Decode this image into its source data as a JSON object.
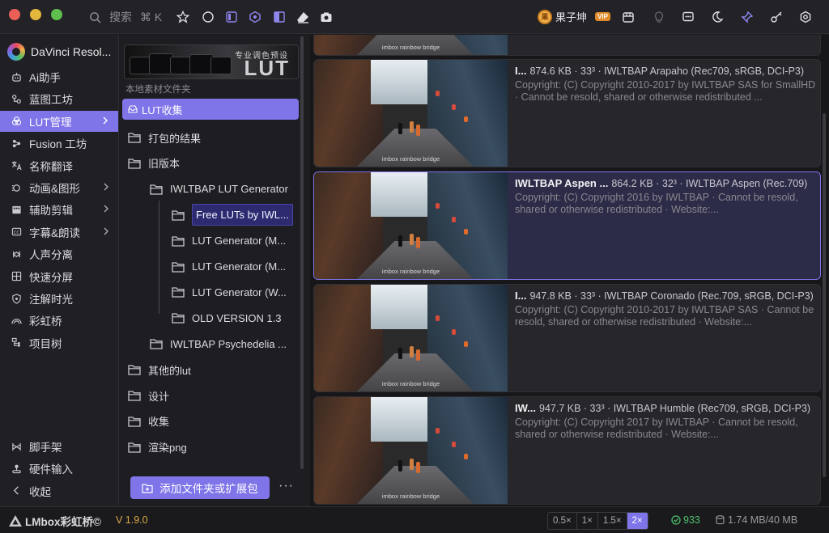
{
  "window": {
    "search_placeholder": "搜索",
    "search_shortcut": "⌘ K",
    "user_name": "果子坤",
    "user_badge": "VIP"
  },
  "sidebar": {
    "app_title": "DaVinci Resol...",
    "items": [
      {
        "label": "Ai助手",
        "icon": "robot-icon"
      },
      {
        "label": "蓝图工坊",
        "icon": "blueprint-icon"
      },
      {
        "label": "LUT管理",
        "icon": "color-circles-icon",
        "active": true
      },
      {
        "label": "Fusion 工坊",
        "icon": "fusion-icon"
      },
      {
        "label": "名称翻译",
        "icon": "translate-icon"
      },
      {
        "label": "动画&图形",
        "icon": "animation-icon"
      },
      {
        "label": "辅助剪辑",
        "icon": "film-icon"
      },
      {
        "label": "字幕&朗读",
        "icon": "caption-icon"
      },
      {
        "label": "人声分离",
        "icon": "vocal-icon"
      },
      {
        "label": "快速分屏",
        "icon": "grid-icon"
      },
      {
        "label": "注解时光",
        "icon": "note-icon"
      },
      {
        "label": "彩虹桥",
        "icon": "rainbow-icon"
      },
      {
        "label": "项目树",
        "icon": "tree-icon"
      }
    ],
    "bottom_items": [
      {
        "label": "脚手架",
        "icon": "scaffold-icon"
      },
      {
        "label": "硬件输入",
        "icon": "joystick-icon"
      },
      {
        "label": "收起",
        "icon": "collapse-icon"
      }
    ]
  },
  "tree": {
    "banner_title": "专业调色预设",
    "banner_big": "LUT",
    "section_label": "本地素材文件夹",
    "root": "LUT收集",
    "folders": [
      {
        "label": "打包的结果"
      },
      {
        "label": "旧版本"
      },
      {
        "label": "IWLTBAP LUT Generator"
      },
      {
        "label": "Free LUTs by IWL..."
      },
      {
        "label": "LUT Generator (M..."
      },
      {
        "label": "LUT Generator (M..."
      },
      {
        "label": "LUT Generator (W..."
      },
      {
        "label": "OLD VERSION 1.3"
      },
      {
        "label": "IWLTBAP Psychedelia ..."
      },
      {
        "label": "其他的lut"
      },
      {
        "label": "设计"
      },
      {
        "label": "收集"
      },
      {
        "label": "渲染png"
      }
    ],
    "add_button": "添加文件夹或扩展包",
    "more_button": "···"
  },
  "thumb_caption": "imbox rainbow bridge",
  "luts": [
    {
      "name": "I...",
      "meta": "874.6 KB · 33³ · IWLTBAP Arapaho (Rec709, sRGB, DCI-P3)",
      "desc": "Copyright: (C) Copyright 2010-2017 by IWLTBAP SAS for SmallHD · Cannot be resold, shared or otherwise redistributed ..."
    },
    {
      "name": "IWLTBAP Aspen ...",
      "meta": "864.2 KB · 32³ · IWLTBAP Aspen (Rec.709)",
      "desc": "Copyright: (C) Copyright 2016 by IWLTBAP · Cannot be resold, shared or otherwise redistributed · Website:...",
      "selected": true
    },
    {
      "name": "I...",
      "meta": "947.8 KB · 33³ · IWLTBAP Coronado (Rec.709, sRGB, DCI-P3)",
      "desc": "Copyright: (C) Copyright 2010-2017 by IWLTBAP SAS · Cannot be resold, shared or otherwise redistributed · Website:..."
    },
    {
      "name": "IW...",
      "meta": "947.7 KB · 33³ · IWLTBAP Humble (Rec709, sRGB, DCI-P3)",
      "desc": "Copyright: (C) Copyright 2017 by IWLTBAP · Cannot be resold, shared or otherwise redistributed · Website:..."
    }
  ],
  "status": {
    "brand": "LMbox彩虹桥©",
    "version": "V 1.9.0",
    "zoom_options": [
      "0.5×",
      "1×",
      "1.5×",
      "2×"
    ],
    "zoom_selected": "2×",
    "count": "933",
    "memory": "1.74 MB/40 MB"
  },
  "colors": {
    "accent": "#7f74e8",
    "count_green": "#4fc06a",
    "version_gold": "#d9a846"
  }
}
